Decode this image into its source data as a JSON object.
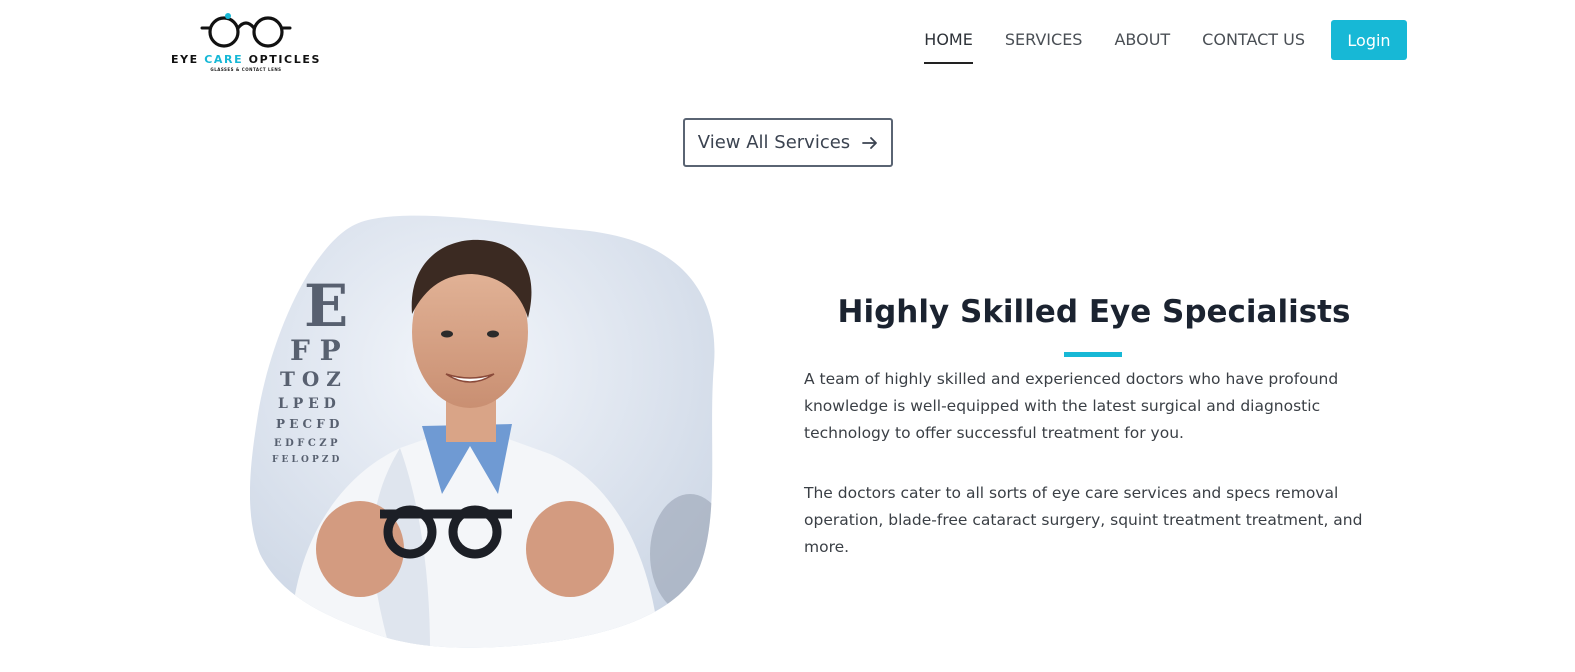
{
  "brand": {
    "name_part1": "EYE ",
    "name_accent": "CARE",
    "name_part2": " OPTICLES",
    "tagline": "GLASSES & CONTACT LENS",
    "accent_color": "#17b8d6"
  },
  "nav": {
    "items": [
      {
        "label": "HOME",
        "active": true
      },
      {
        "label": "SERVICES",
        "active": false
      },
      {
        "label": "ABOUT",
        "active": false
      },
      {
        "label": "CONTACT US",
        "active": false
      }
    ],
    "login_label": "Login"
  },
  "services": {
    "view_all_label": "View All Services",
    "arrow_icon": "arrow-right-icon"
  },
  "specialists": {
    "title": "Highly Skilled Eye Specialists",
    "paragraph1": "A team of highly skilled and experienced doctors who have profound knowledge is well-equipped with the latest surgical and diagnostic technology to offer successful treatment for you.",
    "paragraph2": "The doctors cater to all sorts of eye care services and specs removal operation, blade-free cataract surgery, squint treatment treatment, and more.",
    "eye_chart_rows": [
      "E",
      "F P",
      "T O Z",
      "L P E D",
      "P E C F D",
      "E D F C Z P",
      "F E L O P Z D"
    ]
  }
}
